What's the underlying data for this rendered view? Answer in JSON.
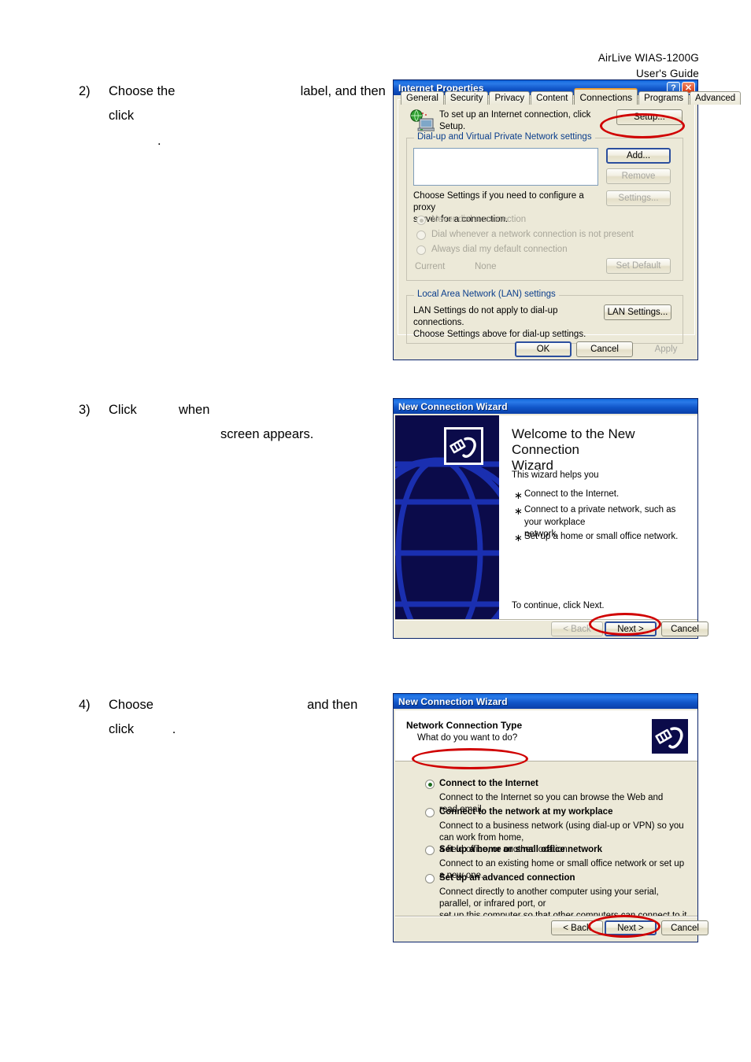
{
  "doc": {
    "header_line1": "AirLive  WIAS-1200G",
    "header_line2": "User's  Guide"
  },
  "steps": [
    {
      "number": "2)",
      "part1": "Choose the",
      "blank1": "",
      "part2": "label, and then click",
      "blank2": "",
      "part3": "."
    },
    {
      "number": "3)",
      "part1": "Click",
      "blank1": "",
      "part2": "when",
      "blank2": "",
      "part3": "screen appears."
    },
    {
      "number": "4)",
      "part1": "Choose",
      "blank1": "",
      "part2": "and then",
      "part3": "click",
      "blank2": "",
      "part4": "."
    }
  ],
  "internet_properties": {
    "title": "Internet Properties",
    "help_button": "?",
    "close_button": "✕",
    "tabs": [
      {
        "label": "General",
        "active": false
      },
      {
        "label": "Security",
        "active": false
      },
      {
        "label": "Privacy",
        "active": false
      },
      {
        "label": "Content",
        "active": false
      },
      {
        "label": "Connections",
        "active": true
      },
      {
        "label": "Programs",
        "active": false
      },
      {
        "label": "Advanced",
        "active": false
      }
    ],
    "setup_text": "To set up an Internet connection, click\nSetup.",
    "setup_button": "Setup...",
    "dialup_group": "Dial-up and Virtual Private Network settings",
    "dialup_list_value": "",
    "add_button": "Add...",
    "remove_button": "Remove",
    "settings_button": "Settings...",
    "proxy_text": "Choose Settings if you need to configure a proxy\nserver for a connection.",
    "radios": [
      {
        "label": "Never dial a connection",
        "selected": true
      },
      {
        "label": "Dial whenever a network connection is not present",
        "selected": false
      },
      {
        "label": "Always dial my default connection",
        "selected": false
      }
    ],
    "current_label": "Current",
    "current_value": "None",
    "set_default_button": "Set Default",
    "lan_group": "Local Area Network (LAN) settings",
    "lan_text": "LAN Settings do not apply to dial-up connections.\nChoose Settings above for dial-up settings.",
    "lan_button": "LAN Settings...",
    "ok_button": "OK",
    "cancel_button": "Cancel",
    "apply_button": "Apply"
  },
  "wizard_welcome": {
    "title": "New Connection Wizard",
    "heading": "Welcome to the New Connection\nWizard",
    "intro": "This wizard helps you",
    "bullets": [
      "Connect to the Internet.",
      "Connect to a private network, such as your workplace\nnetwork.",
      "Set up a home or small office network."
    ],
    "continue_text": "To continue, click Next.",
    "back_button": "< Back",
    "next_button": "Next >",
    "cancel_button": "Cancel"
  },
  "wizard_type": {
    "title": "New Connection Wizard",
    "page_title": "Network Connection Type",
    "page_subtitle": "What do you want to do?",
    "options": [
      {
        "label": "Connect to the Internet",
        "description": "Connect to the Internet so you can browse the Web and read email.",
        "selected": true
      },
      {
        "label": "Connect to the network at my workplace",
        "description": "Connect to a business network (using dial-up or VPN) so you can work from home,\na field office, or another location.",
        "selected": false
      },
      {
        "label": "Set up a home or small office network",
        "description": "Connect to an existing home or small office network or set up a new one.",
        "selected": false
      },
      {
        "label": "Set up an advanced connection",
        "description": "Connect directly to another computer using your serial, parallel, or infrared port, or\nset up this computer so that other computers can connect to it.",
        "selected": false
      }
    ],
    "back_button": "< Back",
    "next_button": "Next >",
    "cancel_button": "Cancel"
  },
  "colors": {
    "annotation": "#d00000",
    "titlebar_blue": "#0a4fc4",
    "dialog_face": "#ece9d8",
    "group_caption": "#0b3e8c",
    "wizard_panel": "#0b0b4a"
  }
}
